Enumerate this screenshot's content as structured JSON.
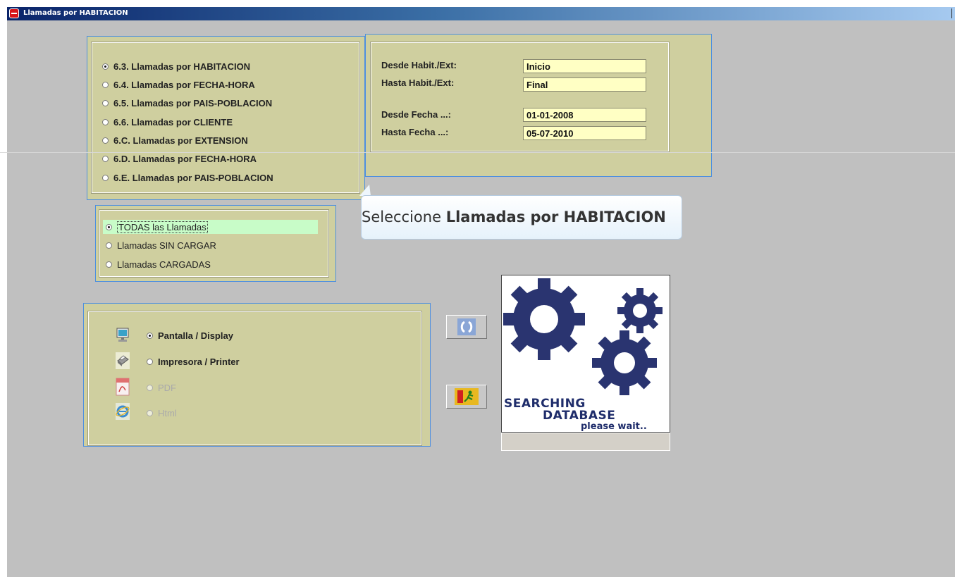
{
  "window": {
    "title": "Llamadas por HABITACION"
  },
  "report_options": [
    {
      "label": "6.3.  Llamadas por HABITACION",
      "selected": true
    },
    {
      "label": "6.4.  Llamadas por FECHA-HORA",
      "selected": false
    },
    {
      "label": "6.5.  Llamadas por PAIS-POBLACION",
      "selected": false
    },
    {
      "label": "6.6.  Llamadas por CLIENTE",
      "selected": false
    },
    {
      "label": "6.C.  Llamadas por EXTENSION",
      "selected": false
    },
    {
      "label": "6.D.  Llamadas por FECHA-HORA",
      "selected": false
    },
    {
      "label": "6.E.  Llamadas por PAIS-POBLACION",
      "selected": false
    }
  ],
  "range": {
    "desde_habit_label": "Desde Habit./Ext:",
    "desde_habit_value": "Inicio",
    "hasta_habit_label": "Hasta Habit./Ext:",
    "hasta_habit_value": "Final",
    "desde_fecha_label": "Desde  Fecha ...:",
    "desde_fecha_value": "01-01-2008",
    "hasta_fecha_label": "Hasta  Fecha ...:",
    "hasta_fecha_value": "05-07-2010"
  },
  "tooltip": {
    "prefix": "Seleccione ",
    "bold": "Llamadas por HABITACION"
  },
  "call_filter": [
    {
      "label": "TODAS las Llamadas",
      "selected": true
    },
    {
      "label": "Llamadas SIN CARGAR",
      "selected": false
    },
    {
      "label": "Llamadas CARGADAS",
      "selected": false
    }
  ],
  "output": [
    {
      "label": "Pantalla / Display",
      "icon": "monitor-icon",
      "selected": true,
      "enabled": true
    },
    {
      "label": "Impresora / Printer",
      "icon": "printer-icon",
      "selected": false,
      "enabled": true
    },
    {
      "label": "PDF",
      "icon": "pdf-icon",
      "selected": false,
      "enabled": false
    },
    {
      "label": "Html",
      "icon": "ie-icon",
      "selected": false,
      "enabled": false
    }
  ],
  "banner": {
    "line1": "SEARCHING",
    "line2": "DATABASE",
    "line3": "please wait.."
  },
  "colors": {
    "panel": "#cfcf9f",
    "field": "#ffffc4",
    "highlight": "#c8fcc8",
    "gear": "#2a3470"
  }
}
